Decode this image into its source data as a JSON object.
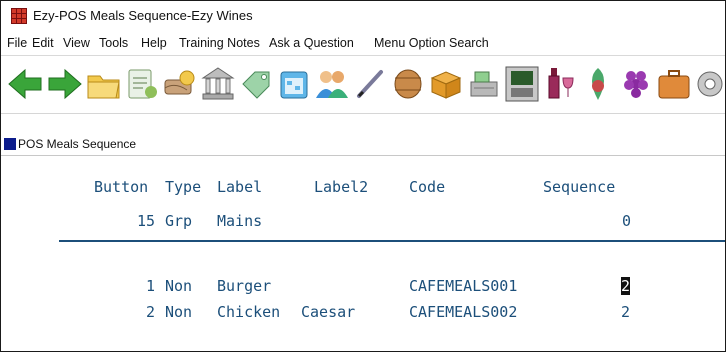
{
  "window": {
    "title": "Ezy-POS Meals Sequence-Ezy Wines"
  },
  "menu": [
    "File",
    "Edit",
    "View",
    "Tools",
    "Help",
    "Training Notes",
    "Ask a Question",
    "Menu Option Search"
  ],
  "toolbar": {
    "buttons": [
      "back-arrow-icon",
      "forward-arrow-icon",
      "folder-icon",
      "invoice-icon",
      "payment-icon",
      "bank-icon",
      "label-tag-icon",
      "calendar-icon",
      "contacts-icon",
      "pen-icon",
      "barrel-icon",
      "box-icon",
      "cash-register-icon",
      "pos-terminal-icon",
      "wine-icon",
      "cellar-icon",
      "grapes-icon",
      "briefcase-icon",
      "settings-icon"
    ]
  },
  "child_window": {
    "title": "POS Meals Sequence"
  },
  "table": {
    "headers": {
      "button": "Button",
      "type": "Type",
      "label": "Label",
      "label2": "Label2",
      "code": "Code",
      "sequence": "Sequence"
    },
    "group": {
      "button": "15",
      "type": "Grp",
      "label": "Mains",
      "sequence": "0"
    },
    "rows": [
      {
        "button": "1",
        "type": "Non",
        "label": "Burger",
        "label2": "",
        "code": "CAFEMEALS001",
        "sequence": "2"
      },
      {
        "button": "2",
        "type": "Non",
        "label": "Chicken",
        "label2": "Caesar",
        "code": "CAFEMEALS002",
        "sequence": "2"
      }
    ]
  },
  "colors": {
    "terminal_text": "#1c4f7a",
    "cursor_bg": "#111111"
  }
}
